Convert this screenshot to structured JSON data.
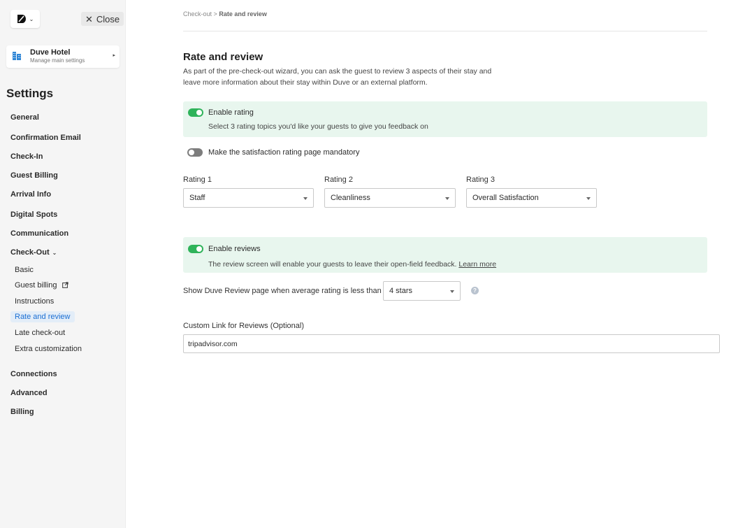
{
  "sidebar": {
    "close_label": "Close",
    "hotel": {
      "name": "Duve Hotel",
      "subtitle": "Manage main settings"
    },
    "settings_title": "Settings",
    "nav": {
      "general": "General",
      "confirmation_email": "Confirmation Email",
      "check_in": "Check-In",
      "guest_billing": "Guest Billing",
      "arrival_info": "Arrival Info",
      "digital_spots": "Digital Spots",
      "communication": "Communication",
      "check_out": "Check-Out",
      "connections": "Connections",
      "advanced": "Advanced",
      "billing": "Billing"
    },
    "checkout_sub": {
      "basic": "Basic",
      "guest_billing": "Guest billing",
      "instructions": "Instructions",
      "rate_and_review": "Rate and review",
      "late_check_out": "Late check-out",
      "extra_customization": "Extra customization"
    }
  },
  "breadcrumb": {
    "parent": "Check-out",
    "separator": ">",
    "current": "Rate and review"
  },
  "page": {
    "title": "Rate and review",
    "description": "As part of the pre-check-out wizard, you can ask the guest to review 3 aspects of their stay and leave more information about their stay within Duve or an external platform."
  },
  "rating_panel": {
    "enabled": true,
    "toggle_label": "Enable rating",
    "subtext": "Select 3 rating topics you'd like your guests to give you feedback on"
  },
  "mandatory": {
    "enabled": false,
    "label": "Make the satisfaction rating page mandatory"
  },
  "ratings": {
    "r1": {
      "label": "Rating 1",
      "value": "Staff"
    },
    "r2": {
      "label": "Rating 2",
      "value": "Cleanliness"
    },
    "r3": {
      "label": "Rating 3",
      "value": "Overall Satisfaction"
    }
  },
  "reviews_panel": {
    "enabled": true,
    "toggle_label": "Enable reviews",
    "subtext": "The review screen will enable your guests to leave their open-field feedback.",
    "learn_more": "Learn more"
  },
  "threshold": {
    "label": "Show Duve Review page when average rating is less than",
    "value": "4 stars",
    "help_icon": "?"
  },
  "custom_link": {
    "label": "Custom Link for Reviews (Optional)",
    "value": "tripadvisor.com"
  },
  "colors": {
    "accent_green": "#2fb35a",
    "panel_green": "#e8f6ee",
    "active_blue": "#1b6fd3"
  }
}
